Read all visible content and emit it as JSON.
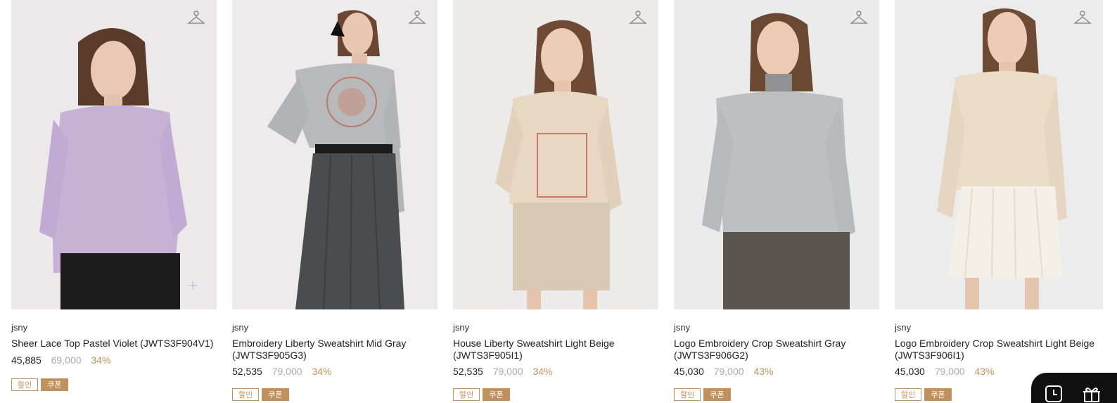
{
  "colors": {
    "accent": "#c1915d",
    "sale_price": "#222222",
    "original_price": "#aaaaaa",
    "image_bg": "#eceaea"
  },
  "products": [
    {
      "brand": "jsny",
      "name": "Sheer Lace Top Pastel Violet (JWTS3F904V1)",
      "price": "45,885",
      "original_price": "69,000",
      "discount": "34%",
      "badge_sale": "할인",
      "badge_coupon": "쿠폰",
      "colors": {
        "top": "#c7b2d6",
        "bottom": "#1c1c1c"
      }
    },
    {
      "brand": "jsny",
      "name": "Embroidery Liberty Sweatshirt Mid Gray (JWTS3F905G3)",
      "price": "52,535",
      "original_price": "79,000",
      "discount": "34%",
      "badge_sale": "할인",
      "badge_coupon": "쿠폰",
      "colors": {
        "top": "#b8b9bb",
        "bottom": "#4a4d50"
      }
    },
    {
      "brand": "jsny",
      "name": "House Liberty Sweatshirt Light Beige (JWTS3F905I1)",
      "price": "52,535",
      "original_price": "79,000",
      "discount": "34%",
      "badge_sale": "할인",
      "badge_coupon": "쿠폰",
      "colors": {
        "top": "#e8d8c3",
        "bottom": "#d8cab4"
      }
    },
    {
      "brand": "jsny",
      "name": "Logo Embroidery Crop Sweatshirt Gray (JWTS3F906G2)",
      "price": "45,030",
      "original_price": "79,000",
      "discount": "43%",
      "badge_sale": "할인",
      "badge_coupon": "쿠폰",
      "colors": {
        "top": "#bdbfc1",
        "bottom": "#5b5550"
      }
    },
    {
      "brand": "jsny",
      "name": "Logo Embroidery Crop Sweatshirt Light Beige (JWTS3F906I1)",
      "price": "45,030",
      "original_price": "79,000",
      "discount": "43%",
      "badge_sale": "할인",
      "badge_coupon": "쿠폰",
      "colors": {
        "top": "#ecdcc8",
        "bottom": "#f4f0e8"
      }
    }
  ],
  "floating_bar": {
    "icons": [
      "clock-icon",
      "gift-icon"
    ]
  }
}
